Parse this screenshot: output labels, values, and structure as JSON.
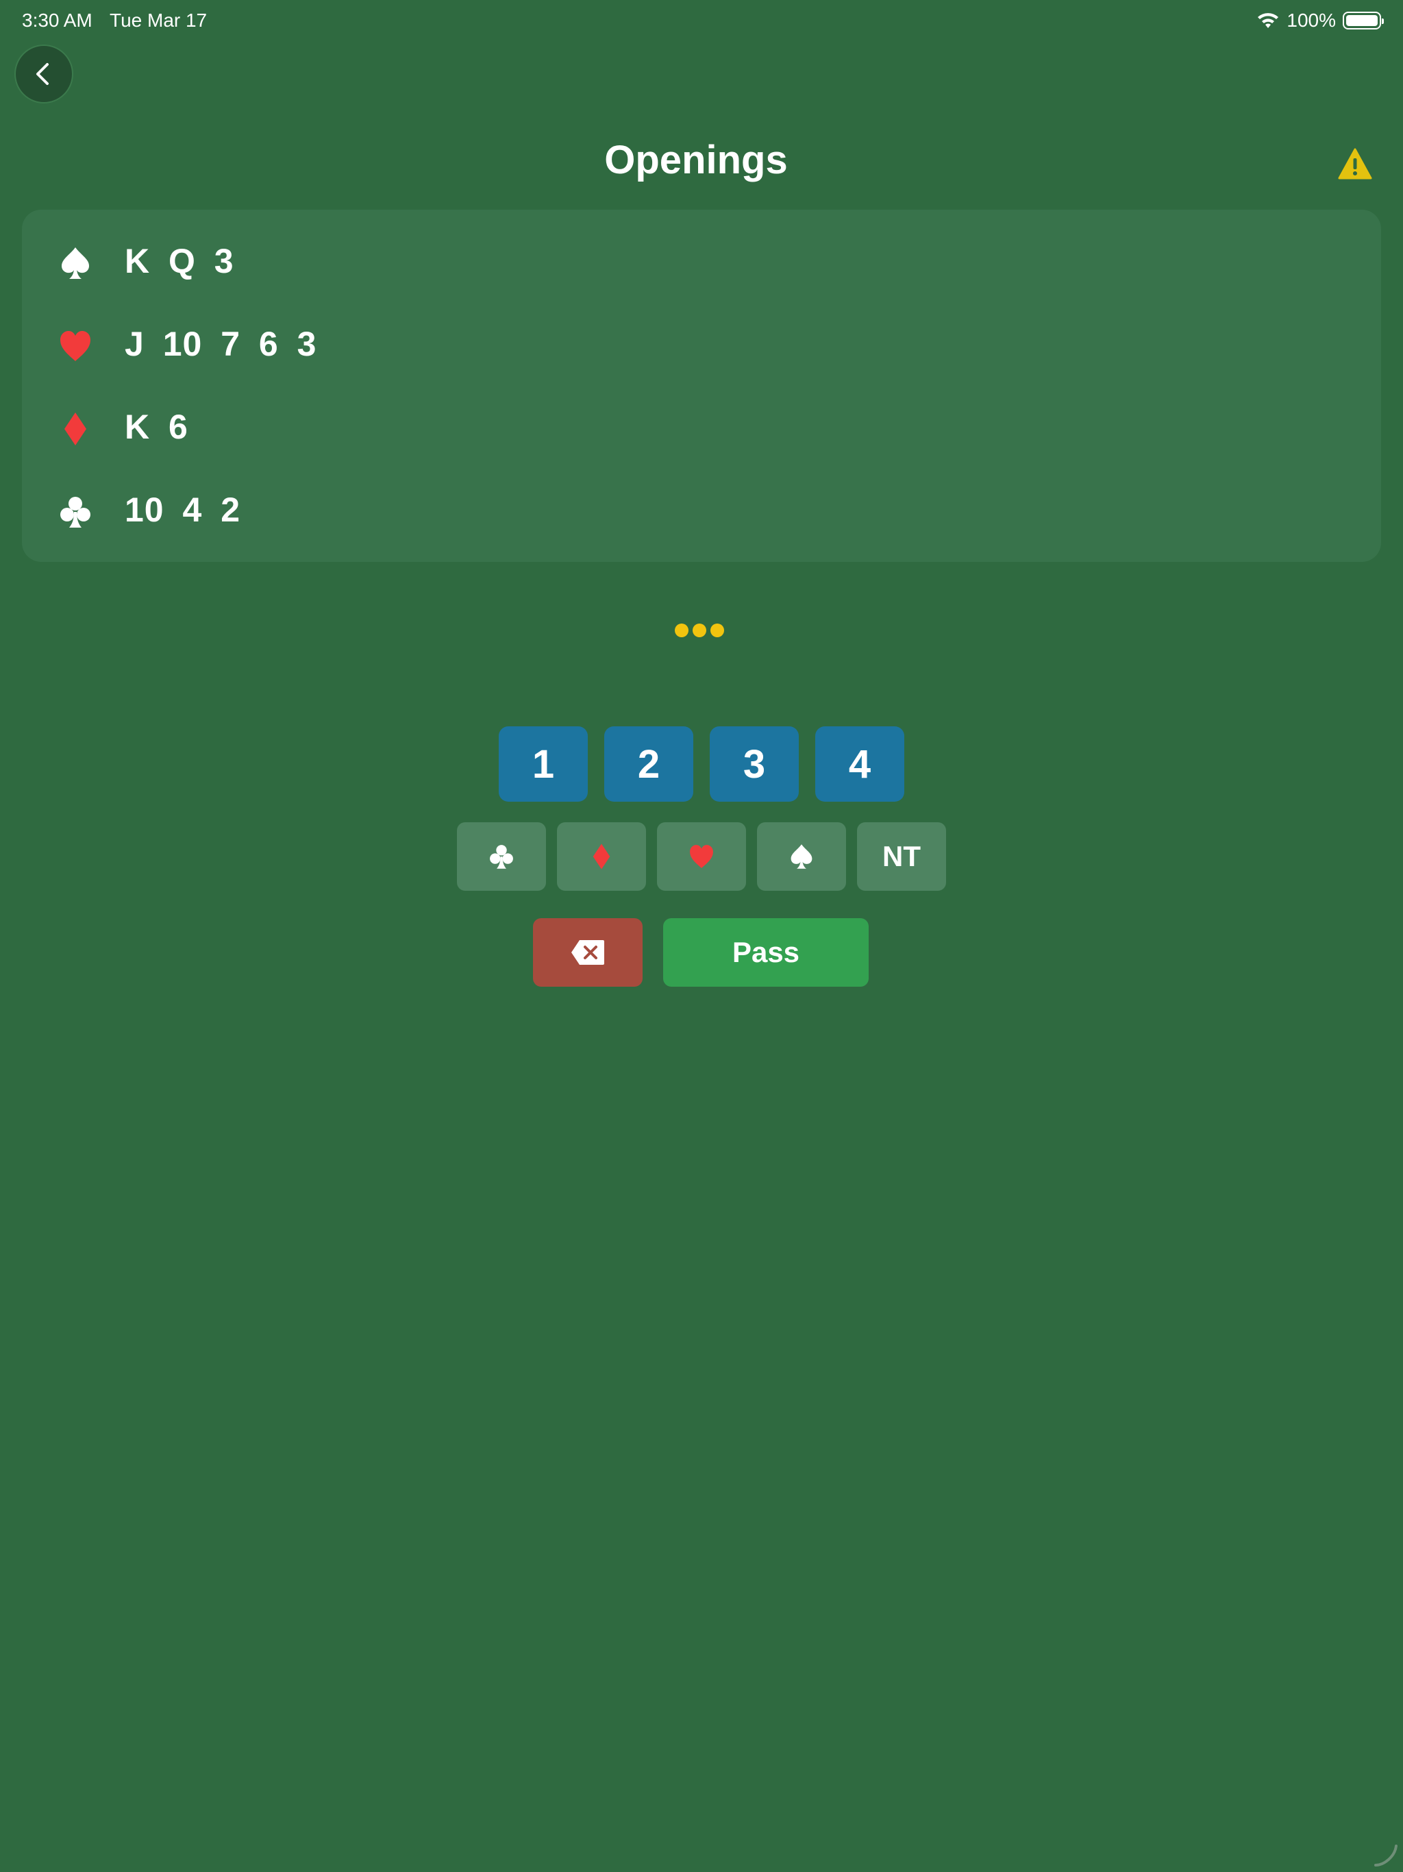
{
  "status_bar": {
    "time": "3:30 AM",
    "date": "Tue Mar 17",
    "battery": "100%"
  },
  "header": {
    "title": "Openings"
  },
  "hand": {
    "spades": "K Q 3",
    "hearts": "J 10 7 6 3",
    "diamonds": "K 6",
    "clubs": "10 4 2"
  },
  "bidding": {
    "levels": [
      "1",
      "2",
      "3",
      "4"
    ],
    "strain_nt": "NT",
    "pass_label": "Pass"
  },
  "colors": {
    "background": "#2f6a40",
    "card_panel": "#38734b",
    "level_button": "#1c75a0",
    "strain_button": "#4e8461",
    "delete_button": "#a64b3d",
    "pass_button": "#33a150",
    "red_suit": "#f23b3b",
    "warning": "#e3c20f"
  },
  "icons": {
    "back": "chevron-left-icon",
    "warning": "warning-triangle-icon",
    "wifi": "wifi-icon",
    "battery": "battery-icon",
    "delete": "backspace-icon"
  }
}
